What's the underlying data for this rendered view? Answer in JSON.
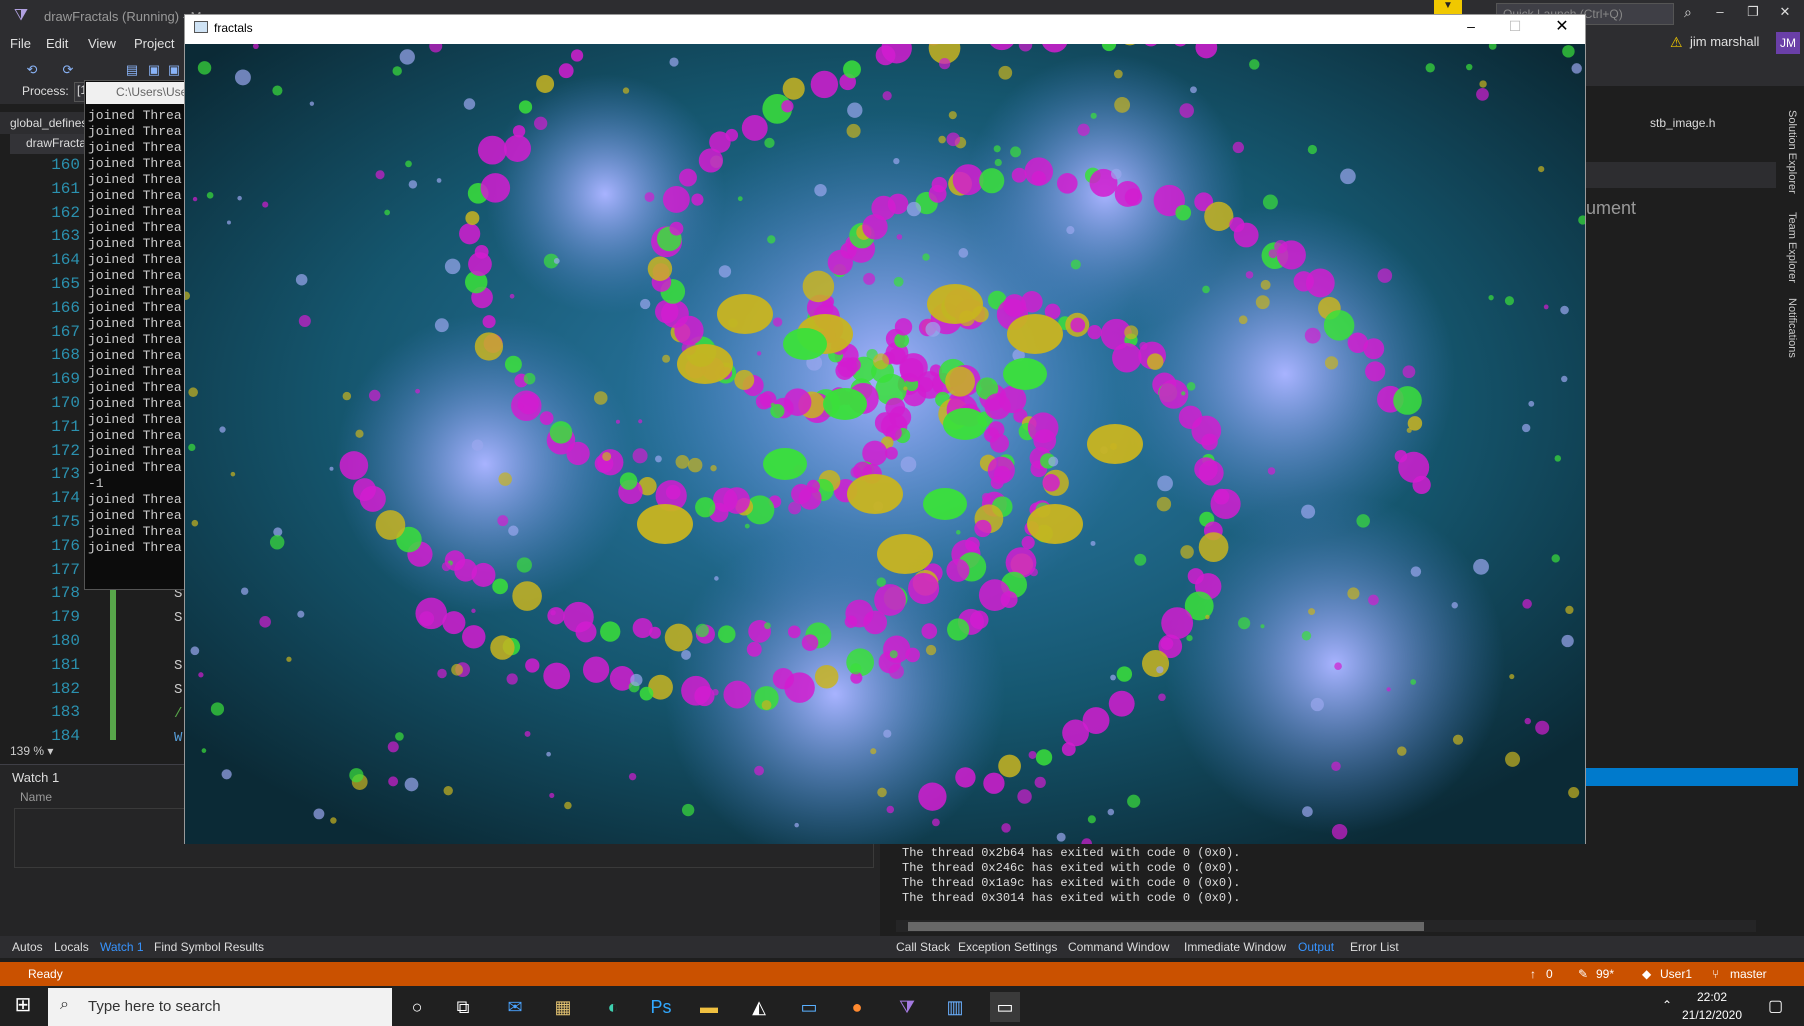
{
  "vs": {
    "window_title": "drawFractals (Running) - M",
    "quick_launch_placeholder": "Quick Launch (Ctrl+Q)",
    "menu": [
      "File",
      "Edit",
      "View",
      "Project"
    ],
    "user_name": "jim marshall",
    "user_initials": "JM",
    "process_label": "Process:",
    "process_value": "[1",
    "doc_tab": "global_defines",
    "nav_project": "drawFracta",
    "stb_tab": "stb_image.h",
    "doc_dropdown": "ument",
    "zoom": "139 %",
    "line_numbers": [
      "160",
      "161",
      "162",
      "163",
      "164",
      "165",
      "166",
      "167",
      "168",
      "169",
      "170",
      "171",
      "172",
      "173",
      "174",
      "175",
      "176",
      "177",
      "178",
      "179",
      "180",
      "181",
      "182",
      "183",
      "184"
    ],
    "vertical_tabs": [
      "Solution Explorer",
      "Team Explorer",
      "Notifications"
    ]
  },
  "console": {
    "title": "C:\\Users\\Use",
    "lines": [
      "joined Threa",
      "joined Threa",
      "joined Threa",
      "joined Threa",
      "joined Threa",
      "joined Threa",
      "joined Threa",
      "joined Threa",
      "joined Threa",
      "joined Threa",
      "joined Threa",
      "joined Threa",
      "joined Threa",
      "joined Threa",
      "joined Threa",
      "joined Threa",
      "joined Threa",
      "joined Threa",
      "joined Threa",
      "joined Threa",
      "joined Threa",
      "joined Threa",
      "joined Threa",
      "-1",
      "joined Threa",
      "joined Threa",
      "joined Threa",
      "joined Threa"
    ]
  },
  "fractal_window": {
    "title": "fractals",
    "colors": {
      "background": "#15566e",
      "light": "#9aa7ee",
      "magenta": "#d21cd0",
      "green": "#3ae03a",
      "yellow": "#c8b420"
    }
  },
  "watch": {
    "title": "Watch 1",
    "name_col": "Name"
  },
  "output": {
    "lines": [
      "The thread 0x2b64 has exited with code 0 (0x0).",
      "The thread 0x246c has exited with code 0 (0x0).",
      "The thread 0x1a9c has exited with code 0 (0x0).",
      "The thread 0x3014 has exited with code 0 (0x0)."
    ]
  },
  "bottom_tabs_left": [
    "Autos",
    "Locals",
    "Watch 1",
    "Find Symbol Results"
  ],
  "bottom_tabs_right": [
    "Call Stack",
    "Exception Settings",
    "Command Window",
    "Immediate Window",
    "Output",
    "Error List"
  ],
  "status": {
    "ready": "Ready",
    "errors": "0",
    "pencil": "99*",
    "user": "User1",
    "branch": "master"
  },
  "taskbar": {
    "search_placeholder": "Type here to search",
    "time": "22:02",
    "date": "21/12/2020"
  }
}
